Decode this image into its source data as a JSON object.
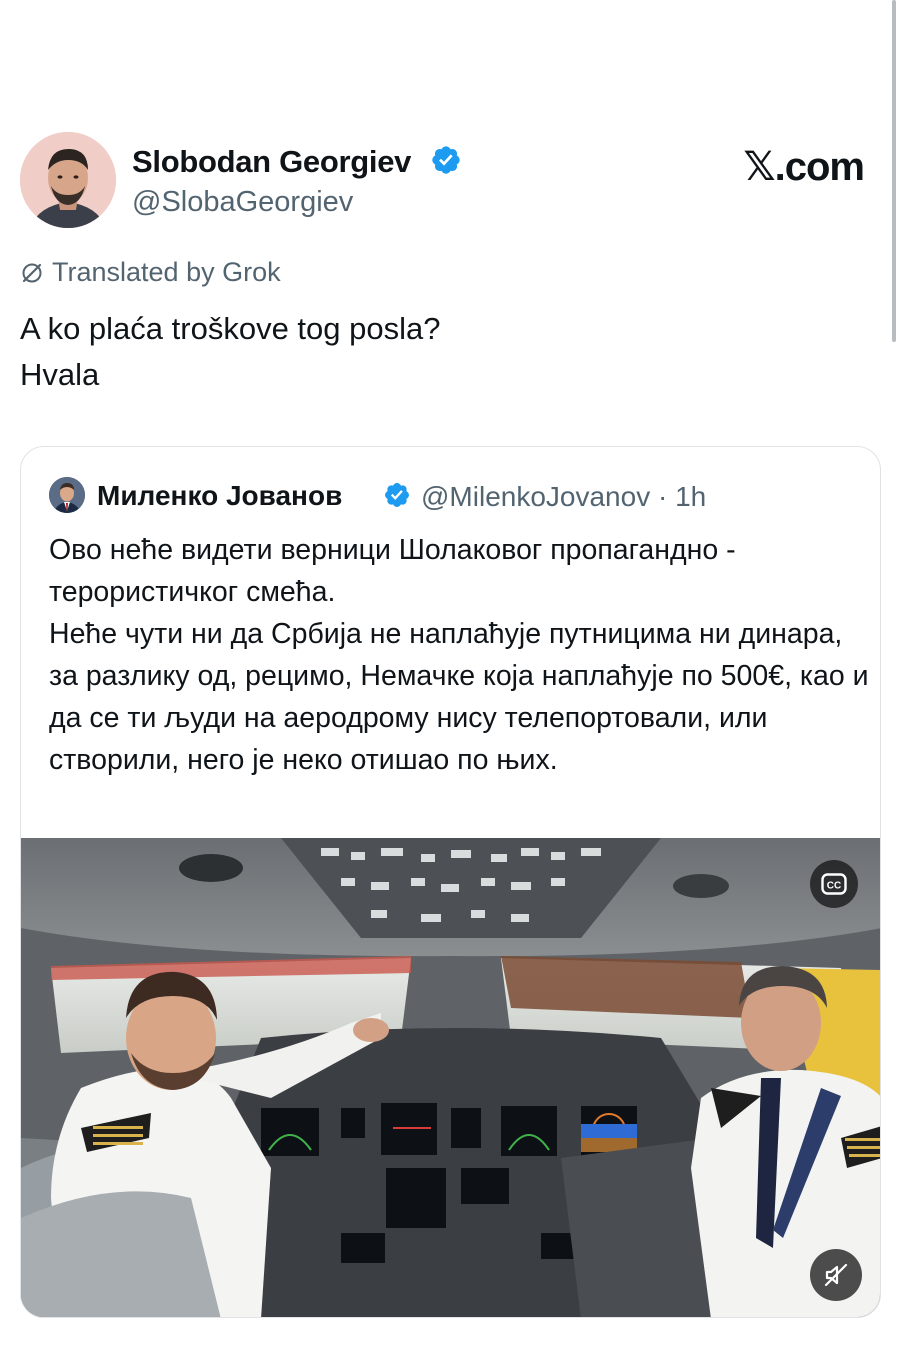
{
  "author": {
    "name": "Slobodan Georgiev",
    "handle": "@SlobaGeorgiev"
  },
  "brand": "𝕏.com",
  "translation": {
    "label": "Translated by Grok"
  },
  "tweet": {
    "lines": [
      "A ko plaća troškove tog posla?",
      "Hvala"
    ]
  },
  "quoted_tweet": {
    "name": "Миленко Јованов",
    "handle": "@MilenkoJovanov · 1h",
    "paragraphs": [
      "Ово неће видети верници Шолаковог пропагандно - терористичког смећа.",
      "Неће чути ни да Србија не наплаћује путницима ни динара, за разлику од, рецимо, Немачке која наплаћује по 500€, као и да се ти људи на аеродрому нису телепортовали, или створили, него је неко отишао по њих."
    ],
    "media": {
      "cc_label": "CC"
    }
  },
  "colors": {
    "verified": "#1d9bf0",
    "secondary_text": "#536471",
    "border": "#dfe3e6"
  },
  "icons": [
    "verified-badge-icon",
    "grok-icon",
    "cc-icon",
    "mute-icon"
  ]
}
